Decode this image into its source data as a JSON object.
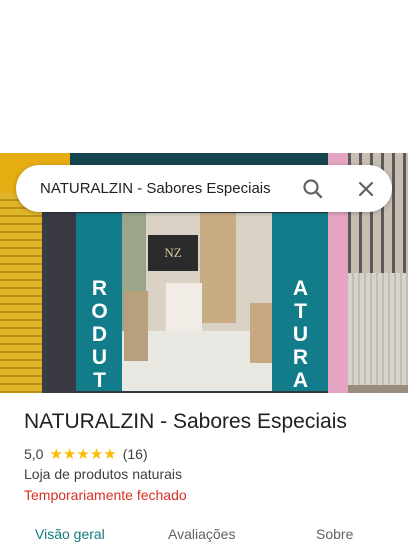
{
  "search": {
    "query": "NATURALZIN - Sabores Especiais"
  },
  "photo": {
    "left_sign_text": "RODUTOS",
    "right_sign_text": "ATURAIS",
    "store_sign_text": "NZ"
  },
  "place": {
    "name": "NATURALZIN - Sabores Especiais",
    "rating": "5,0",
    "stars": "★★★★★",
    "review_count": "(16)",
    "category": "Loja de produtos naturais",
    "status": "Temporariamente fechado"
  },
  "tabs": [
    {
      "label": "Visão geral",
      "active": true
    },
    {
      "label": "Avaliações",
      "active": false
    },
    {
      "label": "Sobre",
      "active": false
    }
  ],
  "colors": {
    "accent": "#137a7f",
    "status_closed": "#d93025",
    "star": "#fbbc04"
  },
  "icons": [
    "search-icon",
    "close-icon"
  ]
}
